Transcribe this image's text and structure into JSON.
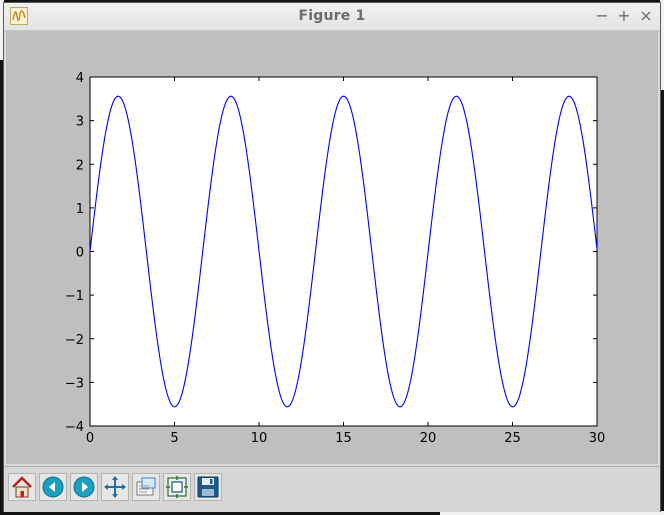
{
  "window": {
    "title": "Figure 1",
    "controls": {
      "minimize": "−",
      "maximize": "+",
      "close": "×"
    }
  },
  "toolbar": {
    "items": [
      {
        "name": "home-button",
        "icon": "home-icon"
      },
      {
        "name": "back-button",
        "icon": "arrow-left-icon"
      },
      {
        "name": "forward-button",
        "icon": "arrow-right-icon"
      },
      {
        "name": "pan-button",
        "icon": "move-arrows-icon"
      },
      {
        "name": "zoom-button",
        "icon": "zoom-rect-icon"
      },
      {
        "name": "subplots-button",
        "icon": "subplots-config-icon"
      },
      {
        "name": "save-button",
        "icon": "floppy-disk-icon"
      }
    ]
  },
  "chart_data": {
    "type": "line",
    "title": "",
    "xlabel": "",
    "ylabel": "",
    "xlim": [
      0,
      30
    ],
    "ylim": [
      -4,
      4
    ],
    "xticks": [
      "0",
      "5",
      "10",
      "15",
      "20",
      "25",
      "30"
    ],
    "yticks": [
      "4",
      "3",
      "2",
      "1",
      "0",
      "−1",
      "−2",
      "−3",
      "−4"
    ],
    "grid": false,
    "line_color": "#0000ff",
    "series": [
      {
        "function": "3.56 * sin(0.942 * x)",
        "amplitude": 3.56,
        "angular_frequency": 0.942,
        "x_start": 0,
        "x_end": 30,
        "approx_peaks_x": [
          1.67,
          8.34,
          15.0,
          21.7,
          28.3
        ],
        "approx_troughs_x": [
          5.0,
          11.7,
          18.3,
          25.0
        ],
        "start_value_y": 0.0,
        "end_value_y": 0.55
      }
    ]
  }
}
